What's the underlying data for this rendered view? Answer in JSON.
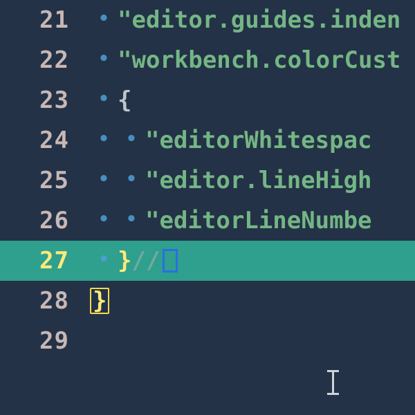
{
  "editor": {
    "highlighted_line": 27,
    "whitespace_glyph": "•",
    "lines": [
      {
        "n": 21,
        "indent": 1,
        "tokens": [
          {
            "t": "\"editor.guides.inden",
            "c": "key"
          }
        ]
      },
      {
        "n": 22,
        "indent": 1,
        "tokens": [
          {
            "t": "\"workbench.colorCust",
            "c": "key"
          }
        ]
      },
      {
        "n": 23,
        "indent": 1,
        "tokens": [
          {
            "t": "{",
            "c": "punc"
          }
        ]
      },
      {
        "n": 24,
        "indent": 2,
        "tokens": [
          {
            "t": "\"editorWhitespac",
            "c": "key"
          }
        ]
      },
      {
        "n": 25,
        "indent": 2,
        "tokens": [
          {
            "t": "\"editor.lineHigh",
            "c": "key"
          }
        ]
      },
      {
        "n": 26,
        "indent": 2,
        "tokens": [
          {
            "t": "\"editorLineNumbe",
            "c": "key"
          }
        ]
      },
      {
        "n": 27,
        "indent": 1,
        "tokens": [
          {
            "t": "}",
            "c": "brace"
          },
          {
            "t": "//",
            "c": "cmt"
          },
          {
            "t": "",
            "c": "cursor"
          }
        ]
      },
      {
        "n": 28,
        "indent": 0,
        "tokens": [
          {
            "t": "}",
            "c": "match"
          }
        ]
      },
      {
        "n": 29,
        "indent": 0,
        "tokens": []
      }
    ]
  }
}
